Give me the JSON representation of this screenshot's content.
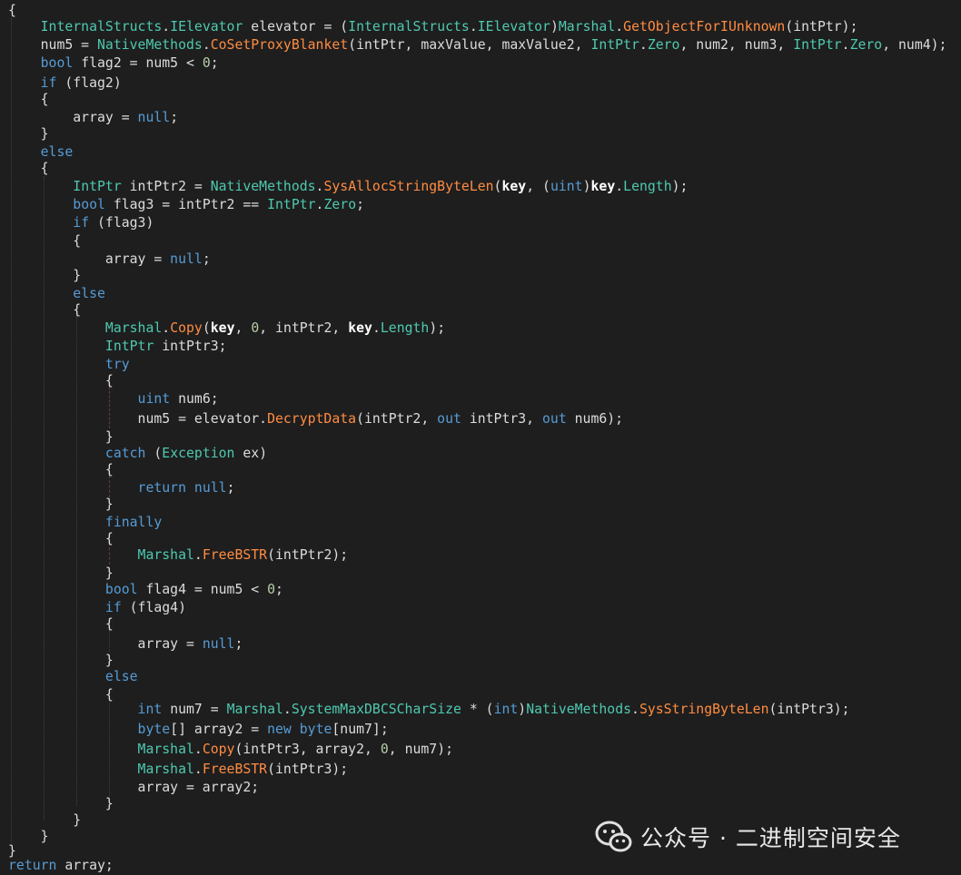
{
  "editor": {
    "language": "csharp",
    "colors": {
      "background": "#1e1e1e",
      "plain": "#dcdcdc",
      "keyword": "#569cd6",
      "type": "#4ec9b0",
      "method": "#ff8c42",
      "number": "#b5cea8"
    },
    "lines": [
      [
        [
          "plain",
          "{"
        ]
      ],
      [
        [
          "plain",
          "    "
        ],
        [
          "type",
          "InternalStructs"
        ],
        [
          "plain",
          "."
        ],
        [
          "type",
          "IElevator"
        ],
        [
          "plain",
          " elevator = ("
        ],
        [
          "type",
          "InternalStructs"
        ],
        [
          "plain",
          "."
        ],
        [
          "type",
          "IElevator"
        ],
        [
          "plain",
          ")"
        ],
        [
          "type",
          "Marshal"
        ],
        [
          "plain",
          "."
        ],
        [
          "method",
          "GetObjectForIUnknown"
        ],
        [
          "plain",
          "(intPtr);"
        ]
      ],
      [
        [
          "plain",
          "    num5 = "
        ],
        [
          "type",
          "NativeMethods"
        ],
        [
          "plain",
          "."
        ],
        [
          "method",
          "CoSetProxyBlanket"
        ],
        [
          "plain",
          "(intPtr, maxValue, maxValue2, "
        ],
        [
          "type",
          "IntPtr"
        ],
        [
          "plain",
          "."
        ],
        [
          "prop",
          "Zero"
        ],
        [
          "plain",
          ", num2, num3, "
        ],
        [
          "type",
          "IntPtr"
        ],
        [
          "plain",
          "."
        ],
        [
          "prop",
          "Zero"
        ],
        [
          "plain",
          ", num4);"
        ]
      ],
      [
        [
          "plain",
          "    "
        ],
        [
          "kw",
          "bool"
        ],
        [
          "plain",
          " flag2 = num5 < "
        ],
        [
          "num",
          "0"
        ],
        [
          "plain",
          ";"
        ]
      ],
      [
        [
          "plain",
          "    "
        ],
        [
          "kw",
          "if"
        ],
        [
          "plain",
          " (flag2)"
        ]
      ],
      [
        [
          "plain",
          "    {"
        ]
      ],
      [
        [
          "plain",
          "        array = "
        ],
        [
          "kw",
          "null"
        ],
        [
          "plain",
          ";"
        ]
      ],
      [
        [
          "plain",
          "    }"
        ]
      ],
      [
        [
          "plain",
          "    "
        ],
        [
          "kw",
          "else"
        ]
      ],
      [
        [
          "plain",
          "    {"
        ]
      ],
      [
        [
          "plain",
          "        "
        ],
        [
          "type",
          "IntPtr"
        ],
        [
          "plain",
          " intPtr2 = "
        ],
        [
          "type",
          "NativeMethods"
        ],
        [
          "plain",
          "."
        ],
        [
          "method",
          "SysAllocStringByteLen"
        ],
        [
          "plain",
          "("
        ],
        [
          "bold",
          "key"
        ],
        [
          "plain",
          ", ("
        ],
        [
          "kw",
          "uint"
        ],
        [
          "plain",
          ")"
        ],
        [
          "bold",
          "key"
        ],
        [
          "plain",
          "."
        ],
        [
          "prop",
          "Length"
        ],
        [
          "plain",
          ");"
        ]
      ],
      [
        [
          "plain",
          "        "
        ],
        [
          "kw",
          "bool"
        ],
        [
          "plain",
          " flag3 = intPtr2 == "
        ],
        [
          "type",
          "IntPtr"
        ],
        [
          "plain",
          "."
        ],
        [
          "prop",
          "Zero"
        ],
        [
          "plain",
          ";"
        ]
      ],
      [
        [
          "plain",
          "        "
        ],
        [
          "kw",
          "if"
        ],
        [
          "plain",
          " (flag3)"
        ]
      ],
      [
        [
          "plain",
          "        {"
        ]
      ],
      [
        [
          "plain",
          "            array = "
        ],
        [
          "kw",
          "null"
        ],
        [
          "plain",
          ";"
        ]
      ],
      [
        [
          "plain",
          "        }"
        ]
      ],
      [
        [
          "plain",
          "        "
        ],
        [
          "kw",
          "else"
        ]
      ],
      [
        [
          "plain",
          "        {"
        ]
      ],
      [
        [
          "plain",
          "            "
        ],
        [
          "type",
          "Marshal"
        ],
        [
          "plain",
          "."
        ],
        [
          "method",
          "Copy"
        ],
        [
          "plain",
          "("
        ],
        [
          "bold",
          "key"
        ],
        [
          "plain",
          ", "
        ],
        [
          "num",
          "0"
        ],
        [
          "plain",
          ", intPtr2, "
        ],
        [
          "bold",
          "key"
        ],
        [
          "plain",
          "."
        ],
        [
          "prop",
          "Length"
        ],
        [
          "plain",
          ");"
        ]
      ],
      [
        [
          "plain",
          "            "
        ],
        [
          "type",
          "IntPtr"
        ],
        [
          "plain",
          " intPtr3;"
        ]
      ],
      [
        [
          "plain",
          "            "
        ],
        [
          "kw",
          "try"
        ]
      ],
      [
        [
          "plain",
          "            {"
        ]
      ],
      [
        [
          "plain",
          "                "
        ],
        [
          "kw",
          "uint"
        ],
        [
          "plain",
          " num6;"
        ]
      ],
      [
        [
          "plain",
          "                num5 = elevator."
        ],
        [
          "method",
          "DecryptData"
        ],
        [
          "plain",
          "(intPtr2, "
        ],
        [
          "kw",
          "out"
        ],
        [
          "plain",
          " intPtr3, "
        ],
        [
          "kw",
          "out"
        ],
        [
          "plain",
          " num6);"
        ]
      ],
      [
        [
          "plain",
          "            }"
        ]
      ],
      [
        [
          "plain",
          "            "
        ],
        [
          "kw",
          "catch"
        ],
        [
          "plain",
          " ("
        ],
        [
          "type",
          "Exception"
        ],
        [
          "plain",
          " ex)"
        ]
      ],
      [
        [
          "plain",
          "            {"
        ]
      ],
      [
        [
          "plain",
          "                "
        ],
        [
          "kw",
          "return"
        ],
        [
          "plain",
          " "
        ],
        [
          "kw",
          "null"
        ],
        [
          "plain",
          ";"
        ]
      ],
      [
        [
          "plain",
          "            }"
        ]
      ],
      [
        [
          "plain",
          "            "
        ],
        [
          "kw",
          "finally"
        ]
      ],
      [
        [
          "plain",
          "            {"
        ]
      ],
      [
        [
          "plain",
          "                "
        ],
        [
          "type",
          "Marshal"
        ],
        [
          "plain",
          "."
        ],
        [
          "method",
          "FreeBSTR"
        ],
        [
          "plain",
          "(intPtr2);"
        ]
      ],
      [
        [
          "plain",
          "            }"
        ]
      ],
      [
        [
          "plain",
          "            "
        ],
        [
          "kw",
          "bool"
        ],
        [
          "plain",
          " flag4 = num5 < "
        ],
        [
          "num",
          "0"
        ],
        [
          "plain",
          ";"
        ]
      ],
      [
        [
          "plain",
          "            "
        ],
        [
          "kw",
          "if"
        ],
        [
          "plain",
          " (flag4)"
        ]
      ],
      [
        [
          "plain",
          "            {"
        ]
      ],
      [
        [
          "plain",
          "                array = "
        ],
        [
          "kw",
          "null"
        ],
        [
          "plain",
          ";"
        ]
      ],
      [
        [
          "plain",
          "            }"
        ]
      ],
      [
        [
          "plain",
          "            "
        ],
        [
          "kw",
          "else"
        ]
      ],
      [
        [
          "plain",
          "            {"
        ]
      ],
      [
        [
          "plain",
          "                "
        ],
        [
          "kw",
          "int"
        ],
        [
          "plain",
          " num7 = "
        ],
        [
          "type",
          "Marshal"
        ],
        [
          "plain",
          "."
        ],
        [
          "prop",
          "SystemMaxDBCSCharSize"
        ],
        [
          "plain",
          " * ("
        ],
        [
          "kw",
          "int"
        ],
        [
          "plain",
          ")"
        ],
        [
          "type",
          "NativeMethods"
        ],
        [
          "plain",
          "."
        ],
        [
          "method",
          "SysStringByteLen"
        ],
        [
          "plain",
          "(intPtr3);"
        ]
      ],
      [
        [
          "plain",
          "                "
        ],
        [
          "kw",
          "byte"
        ],
        [
          "plain",
          "[] array2 = "
        ],
        [
          "kw",
          "new"
        ],
        [
          "plain",
          " "
        ],
        [
          "kw",
          "byte"
        ],
        [
          "plain",
          "[num7];"
        ]
      ],
      [
        [
          "plain",
          "                "
        ],
        [
          "type",
          "Marshal"
        ],
        [
          "plain",
          "."
        ],
        [
          "method",
          "Copy"
        ],
        [
          "plain",
          "(intPtr3, array2, "
        ],
        [
          "num",
          "0"
        ],
        [
          "plain",
          ", num7);"
        ]
      ],
      [
        [
          "plain",
          "                "
        ],
        [
          "type",
          "Marshal"
        ],
        [
          "plain",
          "."
        ],
        [
          "method",
          "FreeBSTR"
        ],
        [
          "plain",
          "(intPtr3);"
        ]
      ],
      [
        [
          "plain",
          "                array = array2;"
        ]
      ],
      [
        [
          "plain",
          "            }"
        ]
      ],
      [
        [
          "plain",
          "        }"
        ]
      ],
      [
        [
          "plain",
          "    }"
        ]
      ],
      [
        [
          "plain",
          "}"
        ]
      ],
      [
        [
          "kw",
          "return"
        ],
        [
          "plain",
          " array;"
        ]
      ]
    ]
  },
  "watermark": {
    "icon": "wechat-icon",
    "text": "公众号 · 二进制空间安全"
  }
}
